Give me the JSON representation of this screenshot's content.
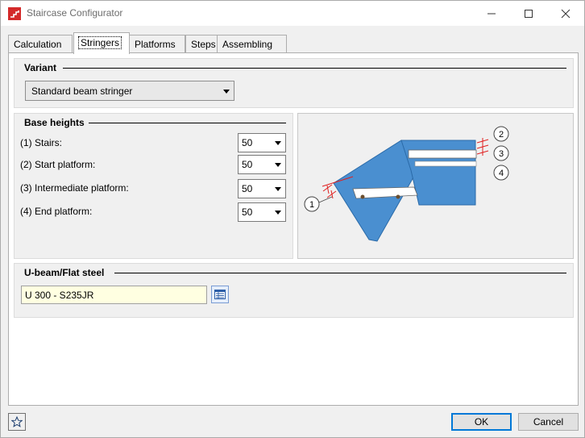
{
  "window": {
    "title": "Staircase Configurator"
  },
  "tabs": [
    {
      "label": "Calculation",
      "active": false
    },
    {
      "label": "Stringers",
      "active": true
    },
    {
      "label": "Platforms",
      "active": false
    },
    {
      "label": "Steps",
      "active": false
    },
    {
      "label": "Assembling",
      "active": false
    }
  ],
  "variant": {
    "title": "Variant",
    "selected": "Standard beam stringer"
  },
  "base_heights": {
    "title": "Base heights",
    "rows": [
      {
        "label": "(1) Stairs:",
        "value": "50"
      },
      {
        "label": "(2) Start platform:",
        "value": "50"
      },
      {
        "label": "(3) Intermediate platform:",
        "value": "50"
      },
      {
        "label": "(4) End platform:",
        "value": "50"
      }
    ]
  },
  "diagram": {
    "callouts": [
      "1",
      "2",
      "3",
      "4"
    ],
    "colors": {
      "beam": "#4a8fd0",
      "beam_stroke": "#2a6aa8",
      "marker": "#e02020"
    }
  },
  "beam": {
    "title": "U-beam/Flat steel",
    "value": "U 300 - S235JR"
  },
  "buttons": {
    "ok": "OK",
    "cancel": "Cancel"
  },
  "icons": {
    "app": "staircase-app-icon",
    "favorite": "star-icon",
    "browse": "catalog-browse-icon"
  }
}
